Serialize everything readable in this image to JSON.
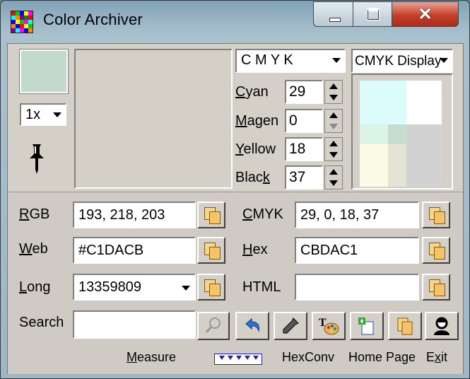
{
  "window": {
    "title": "Color Archiver",
    "close_glyph": "✕"
  },
  "colors": {
    "current_color": "#C1DACB",
    "title_bar": "#9db8c8",
    "panel": "#d4d0c8",
    "close_button": "#c6402b"
  },
  "left_panel": {
    "zoom_value": "1x",
    "pin_icon": "pushpin-icon"
  },
  "cmyk_panel": {
    "mode_value": "C M Y K",
    "display_value": "CMYK Display",
    "channels": [
      {
        "label_pre": "",
        "label_key": "C",
        "label_post": "yan",
        "value": "29"
      },
      {
        "label_pre": "",
        "label_key": "M",
        "label_post": "agen",
        "value": "0"
      },
      {
        "label_pre": "",
        "label_key": "Y",
        "label_post": "ellow",
        "value": "18"
      },
      {
        "label_pre": "Blac",
        "label_key": "k",
        "label_post": "",
        "value": "37"
      }
    ]
  },
  "fields": {
    "rgb": {
      "label_key": "R",
      "label_rest": "GB",
      "value": "193, 218, 203"
    },
    "cmyk": {
      "label_key": "C",
      "label_rest": "MYK",
      "value": "29, 0, 18, 37"
    },
    "web": {
      "label_key": "W",
      "label_rest": "eb",
      "value": "#C1DACB"
    },
    "hex": {
      "label_key": "H",
      "label_rest": "ex",
      "value": "CBDAC1"
    },
    "long": {
      "label_key": "L",
      "label_rest": "ong",
      "value": "13359809"
    },
    "html": {
      "label": "HTML",
      "value": ""
    },
    "search": {
      "label": "Search",
      "value": ""
    }
  },
  "toolbar": {
    "search_icon": "magnifier-icon",
    "buttons": [
      "undo-arrow-icon",
      "eyedropper-icon",
      "text-palette-icon",
      "add-color-icon",
      "copy-pages-icon",
      "user-icon"
    ]
  },
  "footer": {
    "measure_key": "M",
    "measure_rest": "easure",
    "hexconv": "HexConv",
    "home_page": "Home Page",
    "exit_pre": "E",
    "exit_key": "x",
    "exit_post": "it"
  }
}
